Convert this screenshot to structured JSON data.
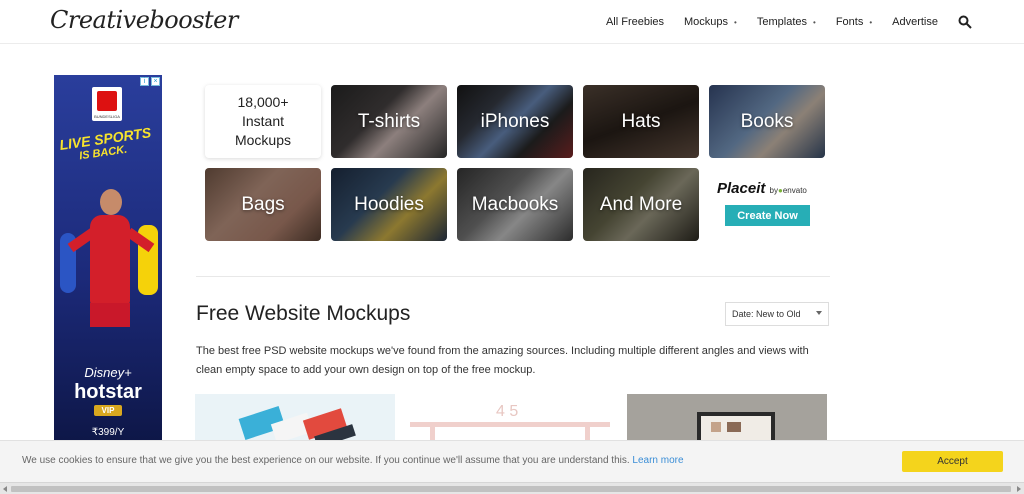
{
  "header": {
    "logo": "Creativebooster",
    "nav": [
      {
        "label": "All Freebies",
        "has_dropdown": false
      },
      {
        "label": "Mockups",
        "has_dropdown": true
      },
      {
        "label": "Templates",
        "has_dropdown": true
      },
      {
        "label": "Fonts",
        "has_dropdown": true
      },
      {
        "label": "Advertise",
        "has_dropdown": false
      }
    ],
    "search_icon": "search-icon"
  },
  "ad": {
    "league": "BUNDESLIGA",
    "headline": "LIVE SPORTS",
    "subheadline": "IS BACK.",
    "brand_top": "Disney+",
    "brand": "hotstar",
    "badge": "VIP",
    "price": "₹399/Y"
  },
  "tiles": {
    "intro": [
      "18,000+",
      "Instant",
      "Mockups"
    ],
    "items": [
      {
        "label": "T-shirts"
      },
      {
        "label": "iPhones"
      },
      {
        "label": "Hats"
      },
      {
        "label": "Books"
      },
      {
        "label": "Bags"
      },
      {
        "label": "Hoodies"
      },
      {
        "label": "Macbooks"
      },
      {
        "label": "And More"
      }
    ]
  },
  "placeit": {
    "logo": "Placeit",
    "by": "by",
    "partner": "envato",
    "cta": "Create Now"
  },
  "section": {
    "title": "Free Website Mockups",
    "sort": "Date: New to Old",
    "description": "The best free PSD website  mockups we've found from the amazing sources. Including multiple different angles and views with clean empty space to add your own design on top of the free mockup."
  },
  "cookie": {
    "text": "We use cookies to ensure that we give you the best experience on our website. If you continue we'll assume that you are understand this.",
    "link": "Learn more",
    "accept": "Accept"
  }
}
